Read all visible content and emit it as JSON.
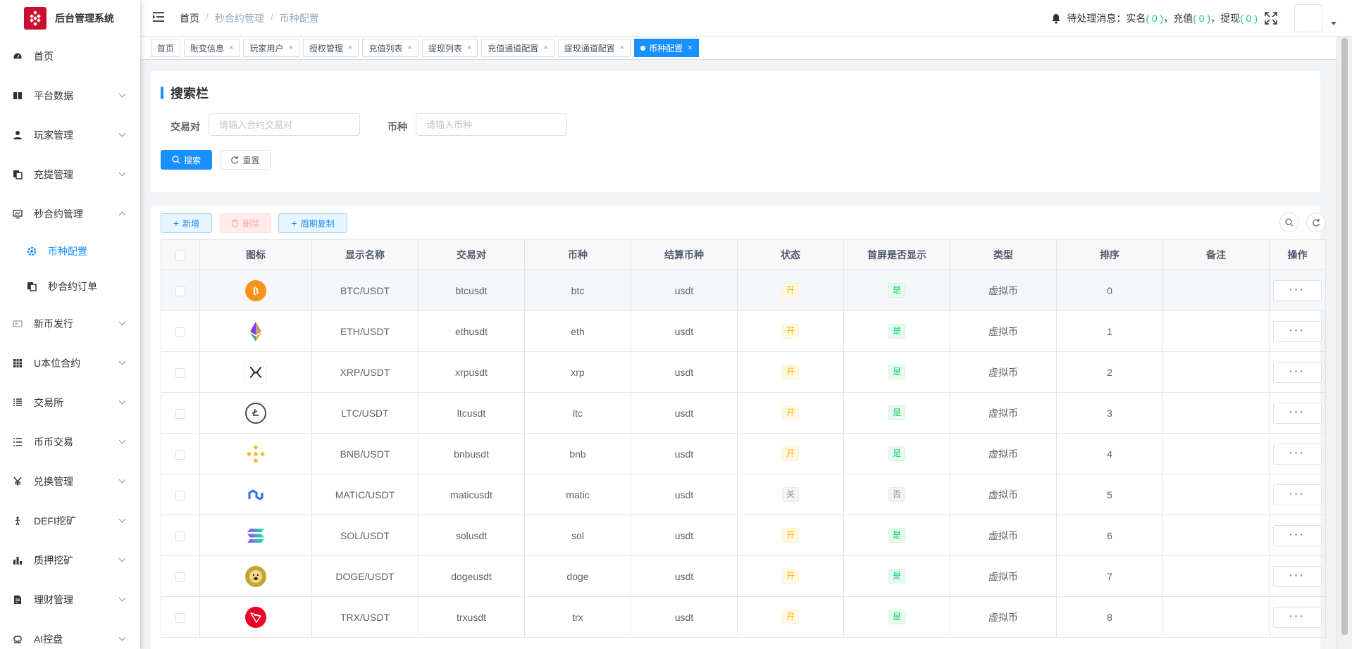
{
  "app": {
    "title": "后台管理系统"
  },
  "sidebar": {
    "items": [
      {
        "label": "首页",
        "icon": "dashboard-icon"
      },
      {
        "label": "平台数据",
        "icon": "book-icon"
      },
      {
        "label": "玩家管理",
        "icon": "user-icon"
      },
      {
        "label": "充提管理",
        "icon": "copy-icon"
      },
      {
        "label": "秒合约管理",
        "icon": "monitor-icon"
      },
      {
        "label": "币种配置",
        "icon": "gear-icon"
      },
      {
        "label": "秒合约订单",
        "icon": "copy-icon"
      },
      {
        "label": "新币发行",
        "icon": "ticket-icon"
      },
      {
        "label": "U本位合约",
        "icon": "table-icon"
      },
      {
        "label": "交易所",
        "icon": "list-icon"
      },
      {
        "label": "币币交易",
        "icon": "list-icon"
      },
      {
        "label": "兑换管理",
        "icon": "yen-icon"
      },
      {
        "label": "DEFI挖矿",
        "icon": "person-walk-icon"
      },
      {
        "label": "质押挖矿",
        "icon": "bar-chart-icon"
      },
      {
        "label": "理财管理",
        "icon": "document-icon"
      },
      {
        "label": "AI控盘",
        "icon": "robot-icon"
      }
    ]
  },
  "header": {
    "breadcrumb": [
      "首页",
      "秒合约管理",
      "币种配置"
    ],
    "notice": {
      "prefix": "待处理消息：实名",
      "realname": "( 0 )",
      "sep1": "，充值",
      "deposit": "( 0 )",
      "sep2": "，提现",
      "withdraw": "( 0 )"
    }
  },
  "tags": [
    "首页",
    "账变信息",
    "玩家用户",
    "授权管理",
    "充值列表",
    "提现列表",
    "充值通道配置",
    "提现通道配置",
    "币种配置"
  ],
  "search": {
    "title": "搜索栏",
    "pair_label": "交易对",
    "pair_placeholder": "请输入合约交易对",
    "coin_label": "币种",
    "coin_placeholder": "请输入币种",
    "search_btn": "搜索",
    "reset_btn": "重置"
  },
  "toolbar": {
    "add": "新增",
    "delete": "删除",
    "copy": "周期复制"
  },
  "table": {
    "columns": [
      "图标",
      "显示名称",
      "交易对",
      "币种",
      "结算币种",
      "状态",
      "首屏是否显示",
      "类型",
      "排序",
      "备注",
      "操作"
    ],
    "more_label": "···",
    "rows": [
      {
        "icon": "bitcoin-icon",
        "name": "BTC/USDT",
        "pair": "btcusdt",
        "coin": "btc",
        "settle": "usdt",
        "status": "开",
        "status_on": true,
        "show": "是",
        "show_on": true,
        "type": "虚拟币",
        "sort": "0",
        "remark": ""
      },
      {
        "icon": "ethereum-icon",
        "name": "ETH/USDT",
        "pair": "ethusdt",
        "coin": "eth",
        "settle": "usdt",
        "status": "开",
        "status_on": true,
        "show": "是",
        "show_on": true,
        "type": "虚拟币",
        "sort": "1",
        "remark": ""
      },
      {
        "icon": "xrp-icon",
        "name": "XRP/USDT",
        "pair": "xrpusdt",
        "coin": "xrp",
        "settle": "usdt",
        "status": "开",
        "status_on": true,
        "show": "是",
        "show_on": true,
        "type": "虚拟币",
        "sort": "2",
        "remark": ""
      },
      {
        "icon": "litecoin-icon",
        "name": "LTC/USDT",
        "pair": "ltcusdt",
        "coin": "ltc",
        "settle": "usdt",
        "status": "开",
        "status_on": true,
        "show": "是",
        "show_on": true,
        "type": "虚拟币",
        "sort": "3",
        "remark": ""
      },
      {
        "icon": "bnb-icon",
        "name": "BNB/USDT",
        "pair": "bnbusdt",
        "coin": "bnb",
        "settle": "usdt",
        "status": "开",
        "status_on": true,
        "show": "是",
        "show_on": true,
        "type": "虚拟币",
        "sort": "4",
        "remark": ""
      },
      {
        "icon": "matic-icon",
        "name": "MATIC/USDT",
        "pair": "maticusdt",
        "coin": "matic",
        "settle": "usdt",
        "status": "关",
        "status_on": false,
        "show": "否",
        "show_on": false,
        "type": "虚拟币",
        "sort": "5",
        "remark": ""
      },
      {
        "icon": "solana-icon",
        "name": "SOL/USDT",
        "pair": "solusdt",
        "coin": "sol",
        "settle": "usdt",
        "status": "开",
        "status_on": true,
        "show": "是",
        "show_on": true,
        "type": "虚拟币",
        "sort": "6",
        "remark": ""
      },
      {
        "icon": "dogecoin-icon",
        "name": "DOGE/USDT",
        "pair": "dogeusdt",
        "coin": "doge",
        "settle": "usdt",
        "status": "开",
        "status_on": true,
        "show": "是",
        "show_on": true,
        "type": "虚拟币",
        "sort": "7",
        "remark": ""
      },
      {
        "icon": "tron-icon",
        "name": "TRX/USDT",
        "pair": "trxusdt",
        "coin": "trx",
        "settle": "usdt",
        "status": "开",
        "status_on": true,
        "show": "是",
        "show_on": true,
        "type": "虚拟币",
        "sort": "8",
        "remark": ""
      }
    ]
  },
  "colors": {
    "primary": "#1890ff",
    "success": "#13ce66",
    "warning": "#ffba00",
    "logo": "#c8102e"
  }
}
